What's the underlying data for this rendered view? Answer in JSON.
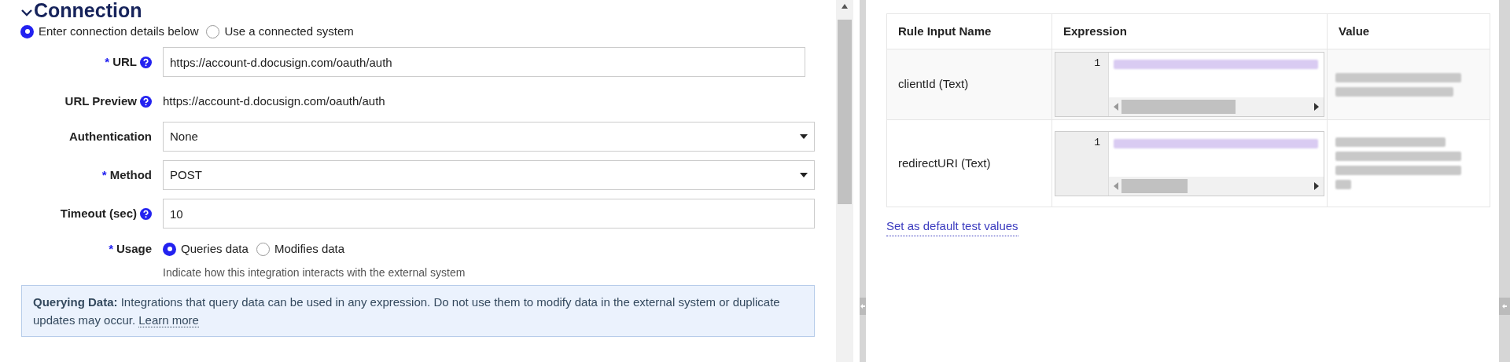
{
  "section": {
    "title": "Connection",
    "expanded": true
  },
  "source_options": [
    {
      "label": "Enter connection details below",
      "selected": true
    },
    {
      "label": "Use a connected system",
      "selected": false
    }
  ],
  "fields": [
    {
      "kind": "input",
      "label": "URL",
      "required_mark": "*",
      "help": true,
      "value": "https://account-d.docusign.com/oauth/auth"
    },
    {
      "kind": "text",
      "label": "URL Preview",
      "help": true,
      "value": "https://account-d.docusign.com/oauth/auth"
    },
    {
      "kind": "select",
      "label": "Authentication",
      "help": false,
      "value": "None"
    },
    {
      "kind": "select",
      "label": "Method",
      "required_mark": "*",
      "help": false,
      "value": "POST"
    },
    {
      "kind": "input",
      "label": "Timeout (sec)",
      "help": true,
      "value": "10"
    }
  ],
  "usage": {
    "label": "Usage",
    "required_mark": "*",
    "options": [
      {
        "label": "Queries data",
        "selected": true
      },
      {
        "label": "Modifies data",
        "selected": false
      }
    ],
    "hint": "Indicate how this integration interacts with the external system"
  },
  "info": {
    "text": "**Querying Data:** Integrations that query data can be used in any expression. Do not use them to modify data in the external system or duplicate updates may occur.",
    "link": "Learn more"
  },
  "test_table": {
    "columns": [
      "Rule Input Name",
      "Expression",
      "Value"
    ],
    "rows": [
      {
        "name": "clientId (Text)",
        "line_number": "1"
      },
      {
        "name": "redirectURI (Text)",
        "line_number": "1"
      }
    ]
  },
  "default_link": "Set as default test values"
}
